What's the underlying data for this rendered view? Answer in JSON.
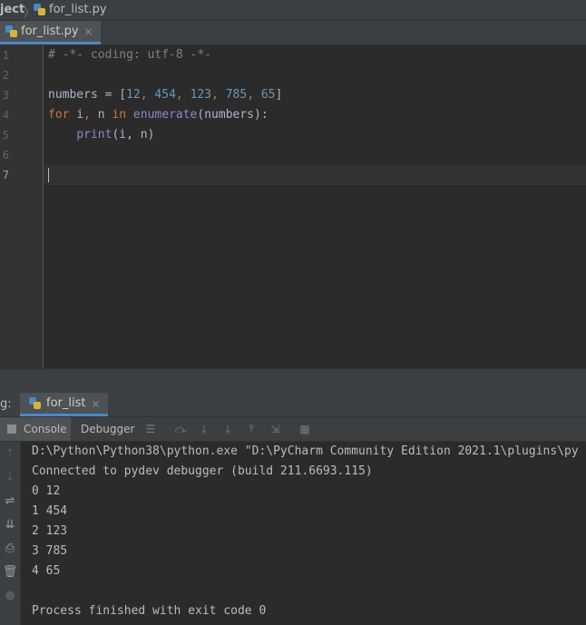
{
  "breadcrumb": {
    "project": "ject",
    "separator": "〉",
    "file": "for_list.py"
  },
  "editor_tab": {
    "label": "for_list.py",
    "close": "×"
  },
  "editor": {
    "line_numbers": [
      "1",
      "2",
      "3",
      "4",
      "5",
      "6",
      "7"
    ],
    "line1": "# -*- coding: utf-8 -*-",
    "line3": {
      "var": "numbers",
      "op": " = [",
      "n1": "12",
      "n2": "454",
      "n3": "123",
      "n4": "785",
      "n5": "65",
      "close": "]",
      "comma": ", "
    },
    "line4": {
      "kw_for": "for",
      "i": " i",
      "comma": ",",
      "n": " n ",
      "kw_in": "in",
      "fn": " enumerate",
      "rest": "(numbers):"
    },
    "line5": {
      "indent": "    ",
      "fn": "print",
      "rest": "(i, n)"
    }
  },
  "debug": {
    "label": "g:",
    "tab_label": "for_list",
    "close": "×",
    "console_tab": "Console",
    "debugger_tab": "Debugger"
  },
  "console": {
    "lines": [
      "D:\\Python\\Python38\\python.exe \"D:\\PyCharm Community Edition 2021.1\\plugins\\py",
      "Connected to pydev debugger (build 211.6693.115)",
      "0 12",
      "1 454",
      "2 123",
      "3 785",
      "4 65",
      "",
      "Process finished with exit code 0"
    ]
  },
  "colors": {
    "accent": "#4a88c7",
    "keyword": "#cc7832",
    "number": "#6897bb",
    "comment": "#808080",
    "builtin": "#8888c6"
  }
}
